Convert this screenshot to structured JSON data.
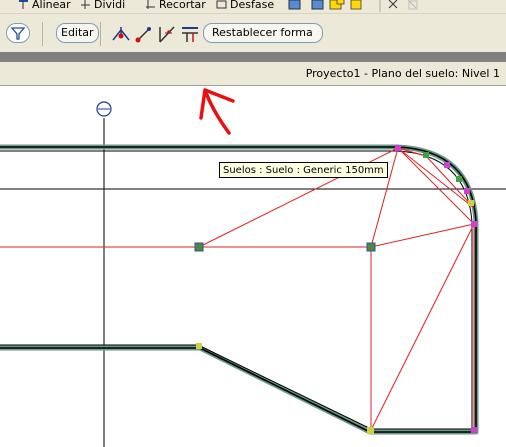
{
  "toolbar_top": {
    "align_label": "Alinear",
    "split_label": "Dividir",
    "trim_label": "Recortar",
    "offset_label": "Desfase"
  },
  "toolbar_main": {
    "edit_label": "Editar",
    "reset_shape_label": "Restablecer forma"
  },
  "view": {
    "title": "Proyecto1 - Plano del suelo: Nivel 1"
  },
  "tooltip": {
    "text": "Suelos : Suelo : Generic 150mm"
  },
  "colors": {
    "annotation": "#e81010",
    "sketch_line": "#e02020",
    "control_point": "#4a8a3a",
    "toolbar_bg": "#ece9d8"
  },
  "icons": [
    "align-icon",
    "split-icon",
    "trim-icon",
    "offset-icon",
    "filter-icon",
    "add-point-icon",
    "add-split-line-icon",
    "pick-supports-icon",
    "reset-shape-icon"
  ]
}
